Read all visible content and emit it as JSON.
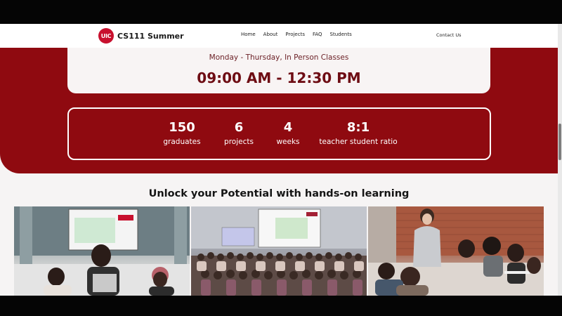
{
  "navbar": {
    "logo_text": "UIC",
    "brand_title": "CS111 Summer",
    "links": [
      "Home",
      "About",
      "Projects",
      "FAQ",
      "Students"
    ],
    "contact": "Contact Us"
  },
  "schedule": {
    "days": "Monday - Thursday, In Person Classes",
    "time": "09:00 AM - 12:30 PM"
  },
  "stats": [
    {
      "value": "150",
      "label": "graduates"
    },
    {
      "value": "6",
      "label": "projects"
    },
    {
      "value": "4",
      "label": "weeks"
    },
    {
      "value": "8:1",
      "label": "teacher student ratio"
    }
  ],
  "section_heading": "Unlock your Potential with hands-on learning",
  "colors": {
    "brand_maroon": "#8f0a10",
    "logo_red": "#c8102e",
    "page_background": "#f6f4f4"
  }
}
